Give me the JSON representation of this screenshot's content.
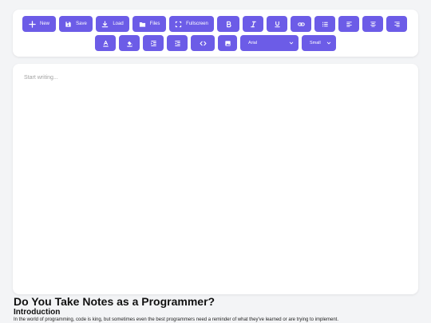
{
  "toolbar": {
    "row1": {
      "new_label": "New",
      "save_label": "Save",
      "load_label": "Load",
      "files_label": "Files",
      "fullscreen_label": "Fullscreen"
    },
    "font_family": {
      "selected": "Arial"
    },
    "font_size": {
      "selected": "Small"
    }
  },
  "editor": {
    "placeholder": "Start writing..."
  },
  "article": {
    "title": "Do You Take Notes as a Programmer?",
    "heading": "Introduction",
    "paragraph": "In the world of programming, code is king, but sometimes even the best programmers need a reminder of what they've learned or are trying to implement."
  },
  "colors": {
    "accent": "#6c5ce7",
    "background": "#f3f4f6",
    "panel": "#ffffff"
  }
}
